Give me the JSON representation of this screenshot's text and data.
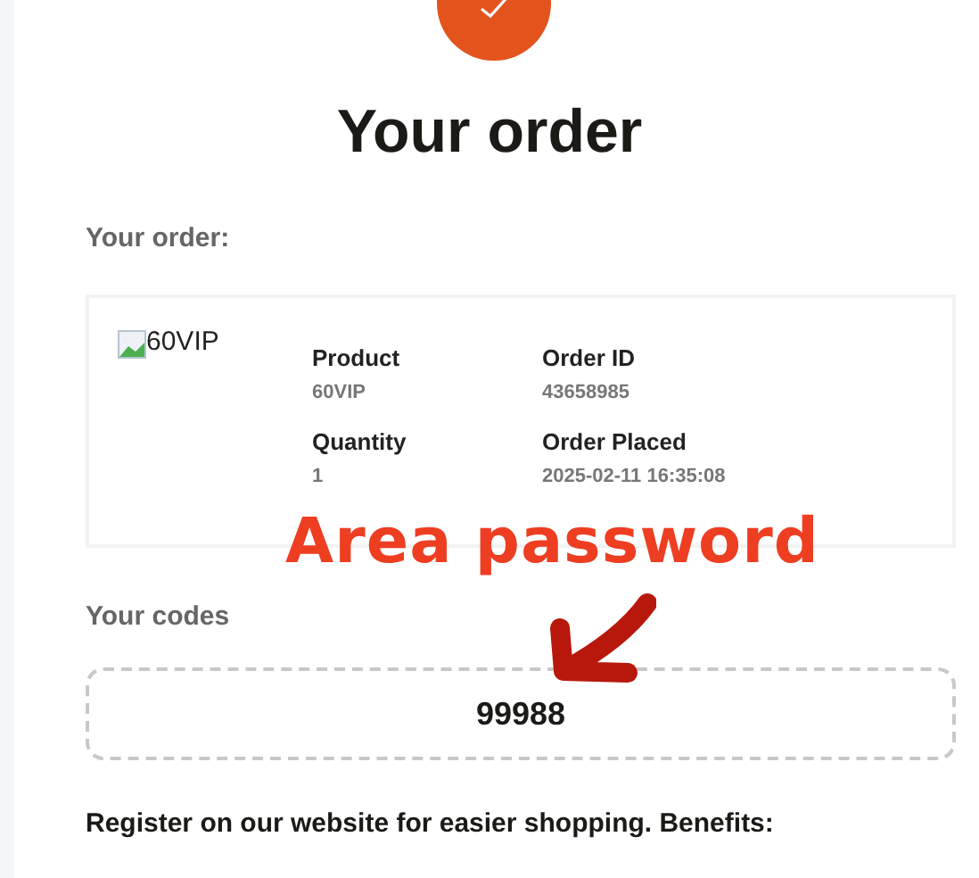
{
  "title": "Your order",
  "order_label": "Your order:",
  "order": {
    "image_alt": "60VIP",
    "fields": [
      {
        "label": "Product",
        "value": "60VIP"
      },
      {
        "label": "Order ID",
        "value": "43658985"
      },
      {
        "label": "Quantity",
        "value": "1"
      },
      {
        "label": "Order Placed",
        "value": "2025-02-11 16:35:08"
      }
    ]
  },
  "annotation": "Area password",
  "codes_label": "Your codes",
  "code": "99988",
  "register_text": "Register on our website for easier shopping. Benefits:"
}
